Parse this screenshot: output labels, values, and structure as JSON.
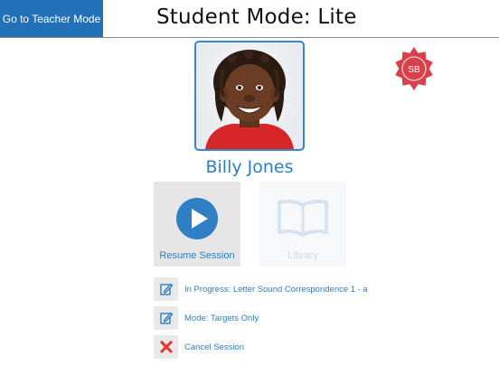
{
  "header": {
    "teacher_mode_button": "Go to Teacher Mode",
    "title": "Student Mode: Lite"
  },
  "badge": {
    "initials": "SB"
  },
  "student": {
    "name": "Billy Jones"
  },
  "tiles": {
    "resume": {
      "label": "Resume Session",
      "icon": "play-icon"
    },
    "library": {
      "label": "Library",
      "icon": "book-icon",
      "enabled": false
    }
  },
  "options": [
    {
      "label": "In Progress: Letter Sound Correspondence 1 - a",
      "icon": "edit-icon"
    },
    {
      "label": "Mode: Targets Only",
      "icon": "edit-icon"
    },
    {
      "label": "Cancel Session",
      "icon": "close-icon"
    }
  ],
  "colors": {
    "accent": "#2170b8",
    "link": "#2e7fc3",
    "seal": "#d8404a",
    "cancel": "#e23a3a"
  }
}
